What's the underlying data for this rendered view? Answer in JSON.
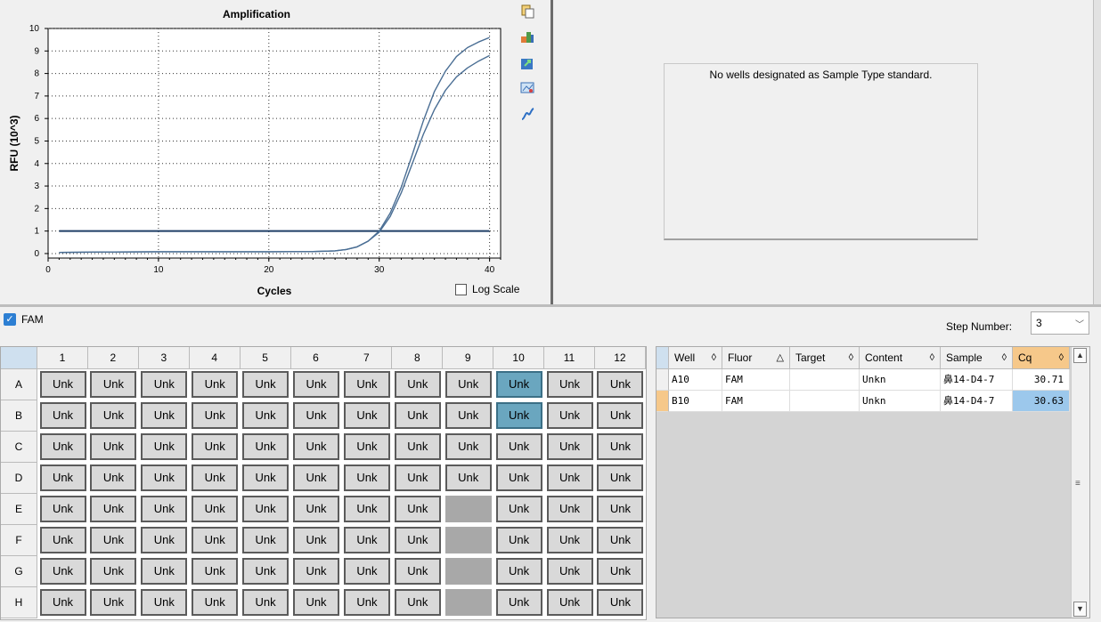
{
  "chart": {
    "title": "Amplification",
    "xlabel": "Cycles",
    "ylabel": "RFU (10^3)",
    "log_scale_label": "Log Scale"
  },
  "chart_data": {
    "type": "line",
    "title": "Amplification",
    "xlabel": "Cycles",
    "ylabel": "RFU (10^3)",
    "xlim": [
      0,
      41
    ],
    "ylim": [
      -0.2,
      10
    ],
    "x_ticks": [
      0,
      10,
      20,
      30,
      40
    ],
    "y_ticks": [
      0,
      1,
      2,
      3,
      4,
      5,
      6,
      7,
      8,
      9,
      10
    ],
    "grid": true,
    "threshold": 1.0,
    "series": [
      {
        "x": [
          1,
          5,
          10,
          15,
          20,
          24,
          26,
          27,
          28,
          29,
          30,
          31,
          32,
          33,
          34,
          35,
          36,
          37,
          38,
          39,
          40
        ],
        "values": [
          0.05,
          0.07,
          0.08,
          0.08,
          0.08,
          0.09,
          0.12,
          0.18,
          0.3,
          0.55,
          1.0,
          1.8,
          2.95,
          4.4,
          5.9,
          7.2,
          8.1,
          8.75,
          9.15,
          9.4,
          9.6
        ]
      },
      {
        "x": [
          1,
          5,
          10,
          15,
          20,
          24,
          26,
          27,
          28,
          29,
          30,
          31,
          32,
          33,
          34,
          35,
          36,
          37,
          38,
          39,
          40
        ],
        "values": [
          0.05,
          0.07,
          0.08,
          0.08,
          0.08,
          0.09,
          0.12,
          0.18,
          0.3,
          0.55,
          0.95,
          1.65,
          2.7,
          4.0,
          5.3,
          6.4,
          7.25,
          7.85,
          8.25,
          8.55,
          8.8
        ]
      }
    ],
    "line_color": "#4a6e94",
    "threshold_color": "#1f3f66"
  },
  "standard_curve": {
    "message": "No wells designated as Sample Type standard."
  },
  "fluor": {
    "label": "FAM",
    "checked": true
  },
  "step": {
    "label": "Step Number:",
    "value": "3"
  },
  "plate": {
    "columns": [
      "1",
      "2",
      "3",
      "4",
      "5",
      "6",
      "7",
      "8",
      "9",
      "10",
      "11",
      "12"
    ],
    "rows": [
      "A",
      "B",
      "C",
      "D",
      "E",
      "F",
      "G",
      "H"
    ],
    "well_label": "Unk",
    "selected_wells": [
      "A10",
      "B10"
    ],
    "empty_wells": [
      "E9",
      "F9",
      "G9",
      "H9"
    ]
  },
  "results": {
    "headers": [
      {
        "label": "Well",
        "sort": "◊"
      },
      {
        "label": "Fluor",
        "sort": "△"
      },
      {
        "label": "Target",
        "sort": "◊"
      },
      {
        "label": "Content",
        "sort": "◊"
      },
      {
        "label": "Sample",
        "sort": "◊"
      },
      {
        "label": "Cq",
        "sort": "◊"
      }
    ],
    "rows": [
      {
        "well": "A10",
        "fluor": "FAM",
        "target": "",
        "content": "Unkn",
        "sample": "鼻14-D4-7",
        "cq": "30.71"
      },
      {
        "well": "B10",
        "fluor": "FAM",
        "target": "",
        "content": "Unkn",
        "sample": "鼻14-D4-7",
        "cq": "30.63"
      }
    ]
  },
  "toolbar_icons": [
    "copy-icon",
    "chart-settings-icon",
    "export-icon",
    "zoom-icon",
    "curve-icon"
  ],
  "colors": {
    "selected_well": "#6aa6bf",
    "active_header": "#f6c88a",
    "selected_cell": "#9cc8ec"
  }
}
